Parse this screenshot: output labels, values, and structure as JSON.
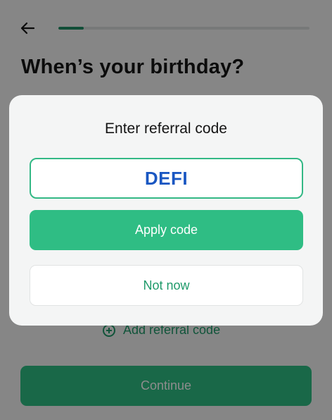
{
  "header": {
    "back_icon": "arrow-left-icon",
    "progress_fraction": 0.1
  },
  "page": {
    "title": "When’s your birthday?",
    "add_referral_label": "Add referral code",
    "add_referral_icon": "plus-circle-icon",
    "continue_label": "Continue"
  },
  "modal": {
    "title": "Enter referral code",
    "code_value": "DEFI",
    "apply_label": "Apply code",
    "not_now_label": "Not now"
  },
  "colors": {
    "accent": "#2fbd84",
    "accent_text": "#1f9a6a",
    "code_text": "#1a57c2"
  }
}
